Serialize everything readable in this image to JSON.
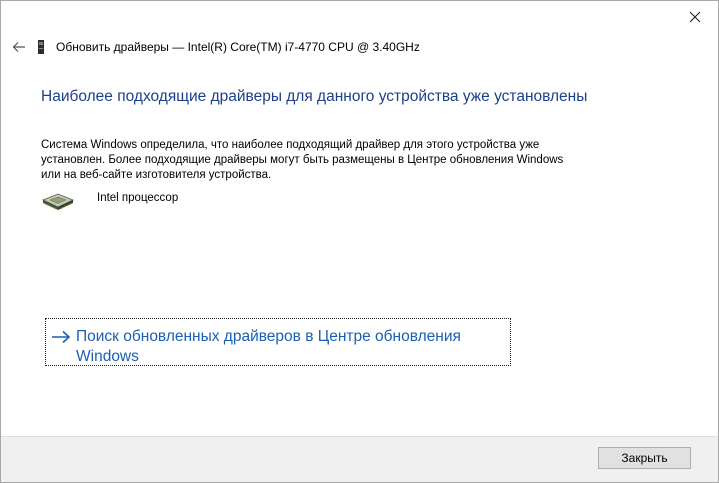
{
  "window": {
    "title": "Обновить драйверы — Intel(R) Core(TM) i7-4770 CPU @ 3.40GHz"
  },
  "content": {
    "heading": "Наиболее подходящие драйверы для данного устройства уже установлены",
    "description": "Система Windows определила, что наиболее подходящий драйвер для этого устройства уже установлен. Более подходящие драйверы могут быть размещены в Центре обновления Windows или на веб-сайте изготовителя устройства.",
    "device_name": "Intel процессор",
    "search_link": "Поиск обновленных драйверов в Центре обновления Windows"
  },
  "footer": {
    "close_label": "Закрыть"
  },
  "icons": {
    "back": "back-arrow-icon",
    "device": "device-icon",
    "processor": "processor-chip-icon",
    "link_arrow": "arrow-right-icon",
    "close": "close-icon"
  },
  "colors": {
    "heading": "#1c3f8c",
    "link": "#1a5fb4",
    "footer_bg": "#f0f0f0"
  }
}
